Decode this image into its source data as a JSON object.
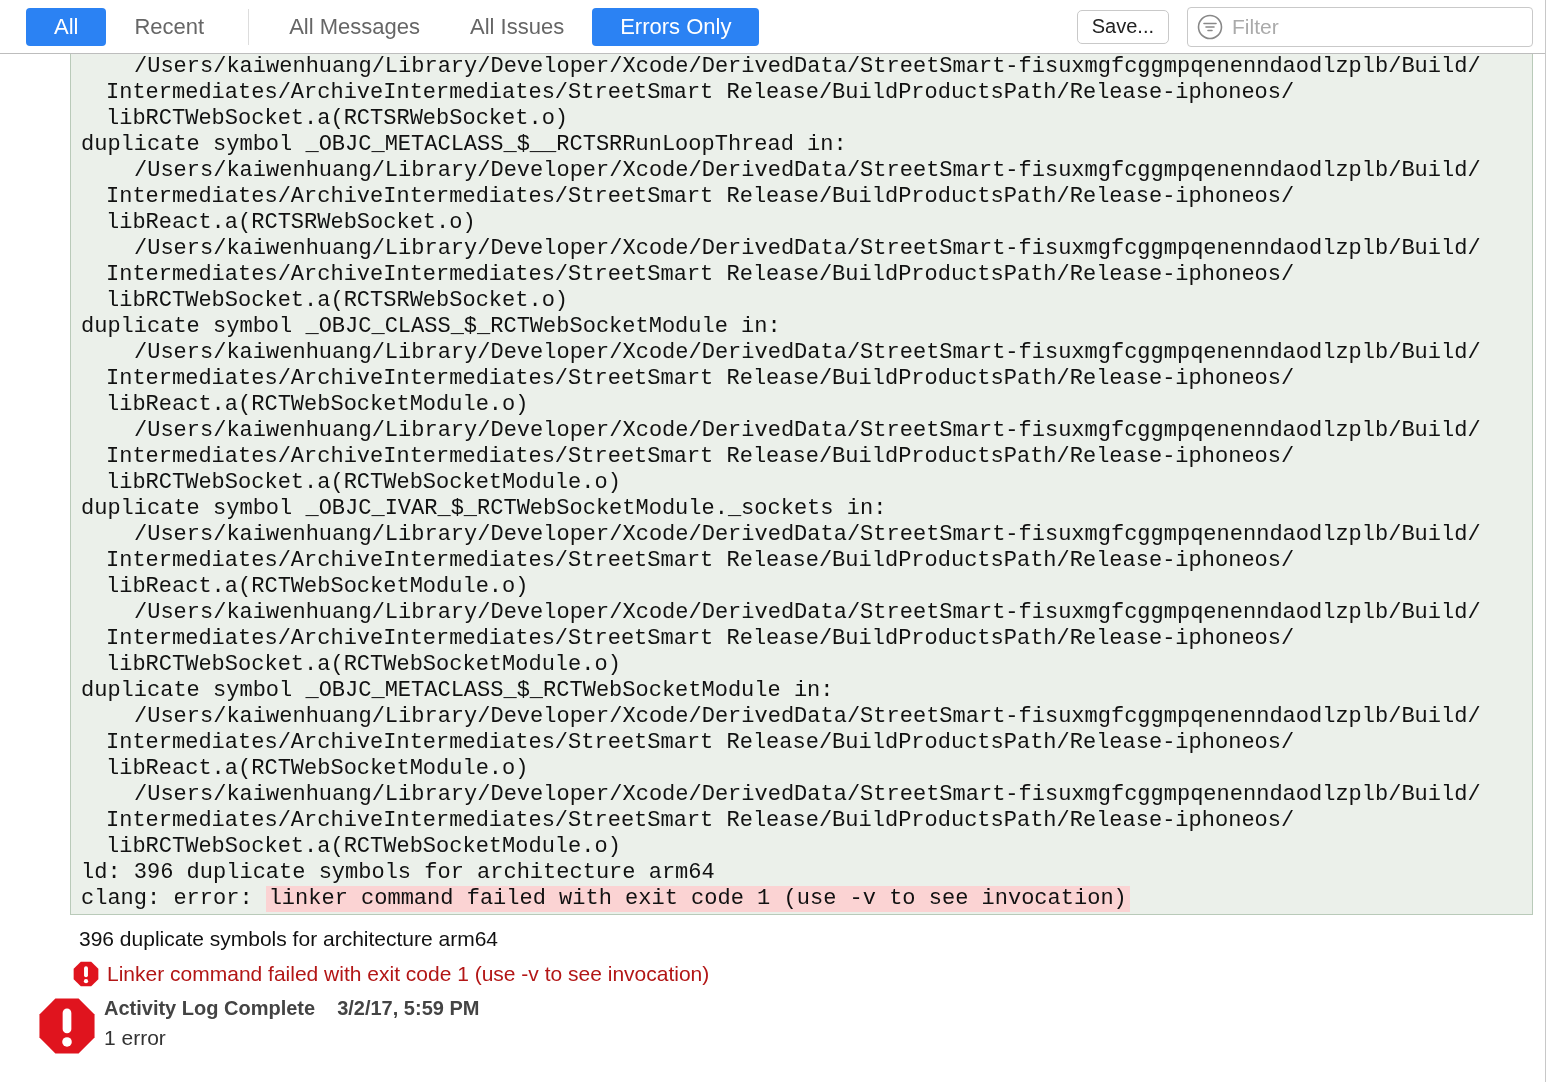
{
  "toolbar": {
    "scope_tabs": [
      {
        "label": "All",
        "selected": true
      },
      {
        "label": "Recent",
        "selected": false
      }
    ],
    "filter_tabs": [
      {
        "label": "All Messages",
        "selected": false
      },
      {
        "label": "All Issues",
        "selected": false
      },
      {
        "label": "Errors Only",
        "selected": true
      }
    ],
    "save_button": "Save...",
    "filter": {
      "placeholder": "Filter"
    }
  },
  "log": {
    "lines": [
      {
        "kind": "path",
        "text": "/Users/kaiwenhuang/Library/Developer/Xcode/DerivedData/StreetSmart-fisuxmgfcggmpqenenndaodlzplb/Build/"
      },
      {
        "kind": "continuation",
        "text": "Intermediates/ArchiveIntermediates/StreetSmart Release/BuildProductsPath/Release-iphoneos/"
      },
      {
        "kind": "continuation",
        "text": "libRCTWebSocket.a(RCTSRWebSocket.o)"
      },
      {
        "kind": "symbol",
        "text": "duplicate symbol _OBJC_METACLASS_$__RCTSRRunLoopThread in:"
      },
      {
        "kind": "path",
        "text": "/Users/kaiwenhuang/Library/Developer/Xcode/DerivedData/StreetSmart-fisuxmgfcggmpqenenndaodlzplb/Build/"
      },
      {
        "kind": "continuation",
        "text": "Intermediates/ArchiveIntermediates/StreetSmart Release/BuildProductsPath/Release-iphoneos/"
      },
      {
        "kind": "continuation",
        "text": "libReact.a(RCTSRWebSocket.o)"
      },
      {
        "kind": "path",
        "text": "/Users/kaiwenhuang/Library/Developer/Xcode/DerivedData/StreetSmart-fisuxmgfcggmpqenenndaodlzplb/Build/"
      },
      {
        "kind": "continuation",
        "text": "Intermediates/ArchiveIntermediates/StreetSmart Release/BuildProductsPath/Release-iphoneos/"
      },
      {
        "kind": "continuation",
        "text": "libRCTWebSocket.a(RCTSRWebSocket.o)"
      },
      {
        "kind": "symbol",
        "text": "duplicate symbol _OBJC_CLASS_$_RCTWebSocketModule in:"
      },
      {
        "kind": "path",
        "text": "/Users/kaiwenhuang/Library/Developer/Xcode/DerivedData/StreetSmart-fisuxmgfcggmpqenenndaodlzplb/Build/"
      },
      {
        "kind": "continuation",
        "text": "Intermediates/ArchiveIntermediates/StreetSmart Release/BuildProductsPath/Release-iphoneos/"
      },
      {
        "kind": "continuation",
        "text": "libReact.a(RCTWebSocketModule.o)"
      },
      {
        "kind": "path",
        "text": "/Users/kaiwenhuang/Library/Developer/Xcode/DerivedData/StreetSmart-fisuxmgfcggmpqenenndaodlzplb/Build/"
      },
      {
        "kind": "continuation",
        "text": "Intermediates/ArchiveIntermediates/StreetSmart Release/BuildProductsPath/Release-iphoneos/"
      },
      {
        "kind": "continuation",
        "text": "libRCTWebSocket.a(RCTWebSocketModule.o)"
      },
      {
        "kind": "symbol",
        "text": "duplicate symbol _OBJC_IVAR_$_RCTWebSocketModule._sockets in:"
      },
      {
        "kind": "path",
        "text": "/Users/kaiwenhuang/Library/Developer/Xcode/DerivedData/StreetSmart-fisuxmgfcggmpqenenndaodlzplb/Build/"
      },
      {
        "kind": "continuation",
        "text": "Intermediates/ArchiveIntermediates/StreetSmart Release/BuildProductsPath/Release-iphoneos/"
      },
      {
        "kind": "continuation",
        "text": "libReact.a(RCTWebSocketModule.o)"
      },
      {
        "kind": "path",
        "text": "/Users/kaiwenhuang/Library/Developer/Xcode/DerivedData/StreetSmart-fisuxmgfcggmpqenenndaodlzplb/Build/"
      },
      {
        "kind": "continuation",
        "text": "Intermediates/ArchiveIntermediates/StreetSmart Release/BuildProductsPath/Release-iphoneos/"
      },
      {
        "kind": "continuation",
        "text": "libRCTWebSocket.a(RCTWebSocketModule.o)"
      },
      {
        "kind": "symbol",
        "text": "duplicate symbol _OBJC_METACLASS_$_RCTWebSocketModule in:"
      },
      {
        "kind": "path",
        "text": "/Users/kaiwenhuang/Library/Developer/Xcode/DerivedData/StreetSmart-fisuxmgfcggmpqenenndaodlzplb/Build/"
      },
      {
        "kind": "continuation",
        "text": "Intermediates/ArchiveIntermediates/StreetSmart Release/BuildProductsPath/Release-iphoneos/"
      },
      {
        "kind": "continuation",
        "text": "libReact.a(RCTWebSocketModule.o)"
      },
      {
        "kind": "path",
        "text": "/Users/kaiwenhuang/Library/Developer/Xcode/DerivedData/StreetSmart-fisuxmgfcggmpqenenndaodlzplb/Build/"
      },
      {
        "kind": "continuation",
        "text": "Intermediates/ArchiveIntermediates/StreetSmart Release/BuildProductsPath/Release-iphoneos/"
      },
      {
        "kind": "continuation",
        "text": "libRCTWebSocket.a(RCTWebSocketModule.o)"
      },
      {
        "kind": "symbol",
        "text": "ld: 396 duplicate symbols for architecture arm64"
      },
      {
        "kind": "error",
        "prefix": "clang: error:",
        "highlight": "linker command failed with exit code 1 (use -v to see invocation)"
      }
    ]
  },
  "summary": "396 duplicate symbols for architecture arm64",
  "error_message": "Linker command failed with exit code 1 (use -v to see invocation)",
  "status": {
    "title": "Activity Log Complete",
    "time": "3/2/17, 5:59 PM",
    "count": "1 error"
  }
}
